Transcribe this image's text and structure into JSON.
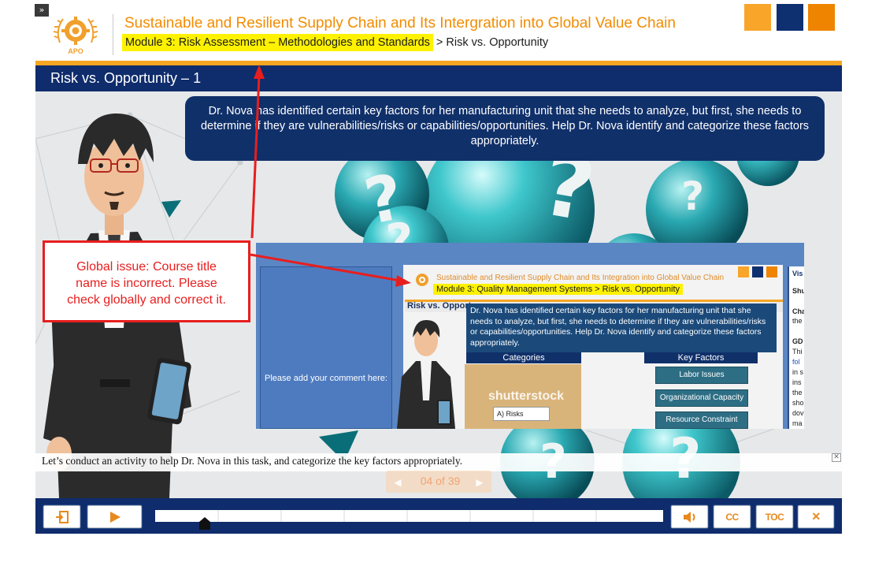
{
  "header": {
    "course_title": "Sustainable and Resilient Supply Chain and Its Intergration into Global Value Chain",
    "breadcrumb_module": "Module 3: Risk Assessment – Methodologies and Standards",
    "breadcrumb_sep": " > ",
    "breadcrumb_page": "Risk vs. Opportunity",
    "logo_text": "APO",
    "expand_label": "»"
  },
  "slide": {
    "title": "Risk vs. Opportunity – 1",
    "bubble_text": "Dr. Nova has identified certain key factors for her manufacturing unit that she needs to analyze, but first, she needs to determine if they are vulnerabilities/risks or capabilities/opportunities. Help Dr. Nova identify and categorize these factors appropriately."
  },
  "inner_screenshot": {
    "comment_prompt": "Please add your comment here:",
    "course_title": "Sustainable and Resilient Supply Chain and Its Integration into Global Value Chain",
    "breadcrumb": "Module 3: Quality Management Systems > Risk vs. Opportunity",
    "slide_title": "Risk vs. Opport",
    "callout": "Dr. Nova has identified certain key factors for her manufacturing unit that she needs to analyze, but first, she needs to determine if they are vulnerabilities/risks or capabilities/opportunities. Help Dr.  Nova identify and categorize these factors appropriately.",
    "categories_head": "Categories",
    "key_factors_head": "Key Factors",
    "risk_label": "A) Risks",
    "watermark": "shutterstock",
    "key_factors": [
      "Labor Issues",
      "Organizational Capacity",
      "Resource Constraint"
    ],
    "side_panel": [
      "Vis",
      "Shu",
      "Cha",
      "the",
      "GD",
      "Thi",
      "fol",
      "in s",
      "ins",
      "the",
      "sho",
      "dov",
      "ma"
    ]
  },
  "annotation": {
    "text": "Global issue: Course title\nname is incorrect. Please\ncheck globally and correct it."
  },
  "caption": {
    "text": "Let’s conduct an activity to help Dr. Nova in this task, and categorize the key factors appropriately.",
    "close": "✕"
  },
  "pager": {
    "text": "04 of 39",
    "prev": "◀",
    "next": "▶"
  },
  "controls": {
    "exit": "exit-icon",
    "play": "play-icon",
    "volume": "volume-icon",
    "cc": "CC",
    "toc": "TOC",
    "close": "✕",
    "progress": 0.1
  },
  "colors": {
    "navy": "#0f2c6c",
    "orange": "#f6a623",
    "accent_orange": "#f28c00",
    "highlight": "#fff200",
    "annotation_red": "#e81e1e"
  }
}
